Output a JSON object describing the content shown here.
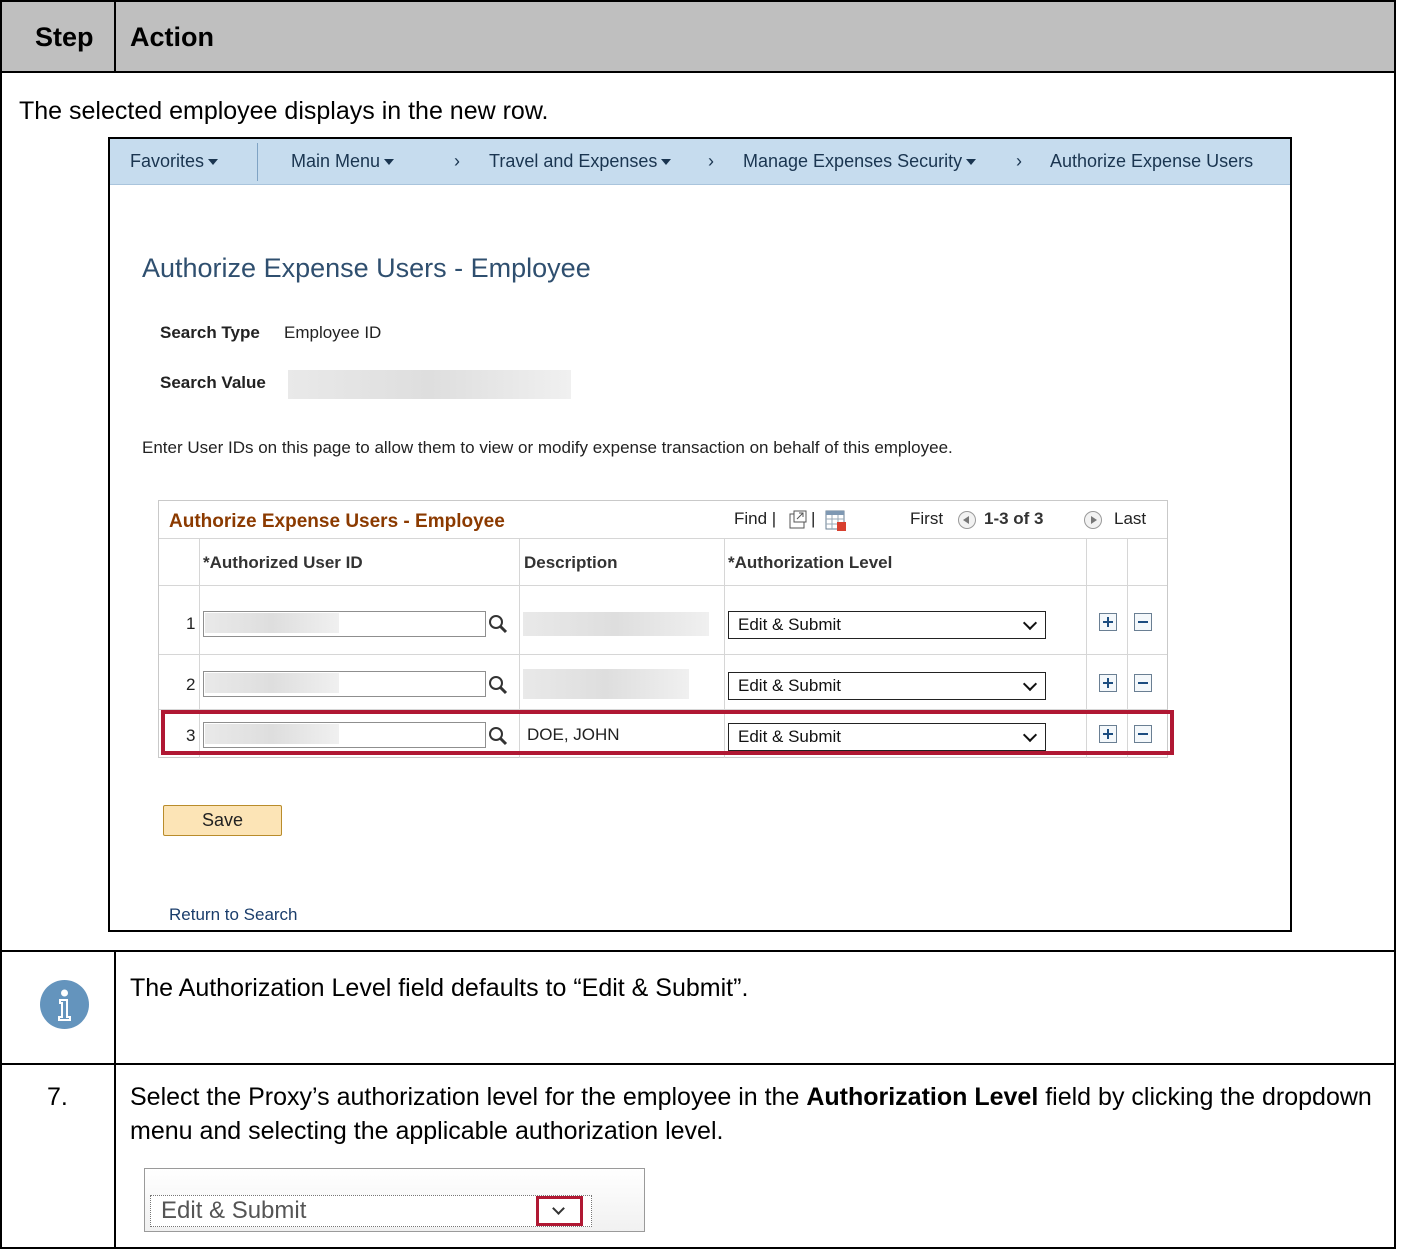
{
  "doc": {
    "header_step": "Step",
    "header_action": "Action",
    "intro_text": "The selected employee displays in the new row.",
    "note_text": "The Authorization Level field defaults to “Edit & Submit”.",
    "step_number": "7.",
    "step_text_before": "Select the Proxy’s authorization level for the employee in the ",
    "step_text_bold": "Authorization Level",
    "step_text_after": " field by clicking the dropdown menu and selecting the applicable authorization level.",
    "example_select_value": "Edit & Submit"
  },
  "nav": {
    "favorites": "Favorites",
    "main_menu": "Main Menu",
    "travel": "Travel and Expenses",
    "manage": "Manage Expenses Security",
    "current": "Authorize Expense Users"
  },
  "page": {
    "title": "Authorize Expense Users - Employee",
    "search_type_label": "Search Type",
    "search_type_value": "Employee ID",
    "search_value_label": "Search Value",
    "instructions": "Enter User IDs on this page to allow them to view or modify expense transaction on behalf of this employee.",
    "save_label": "Save",
    "return_label": "Return to Search"
  },
  "grid": {
    "title": "Authorize Expense Users - Employee",
    "find": "Find",
    "first": "First",
    "range": "1-3 of 3",
    "last": "Last",
    "col_user": "*Authorized User ID",
    "col_desc": "Description",
    "col_level": "*Authorization Level",
    "rows": [
      {
        "num": "1",
        "desc": "",
        "level": "Edit & Submit"
      },
      {
        "num": "2",
        "desc": "",
        "level": "Edit & Submit"
      },
      {
        "num": "3",
        "desc": "DOE, JOHN",
        "level": "Edit & Submit"
      }
    ]
  },
  "colors": {
    "highlight": "#b01833",
    "nav_bg": "#c6dcee",
    "header_bg": "#bfbfbf",
    "info_icon": "#6494bd"
  },
  "icons": [
    "lookup-icon",
    "add-row-icon",
    "delete-row-icon",
    "new-window-icon",
    "spreadsheet-icon",
    "info-icon",
    "dropdown-arrow-icon"
  ]
}
